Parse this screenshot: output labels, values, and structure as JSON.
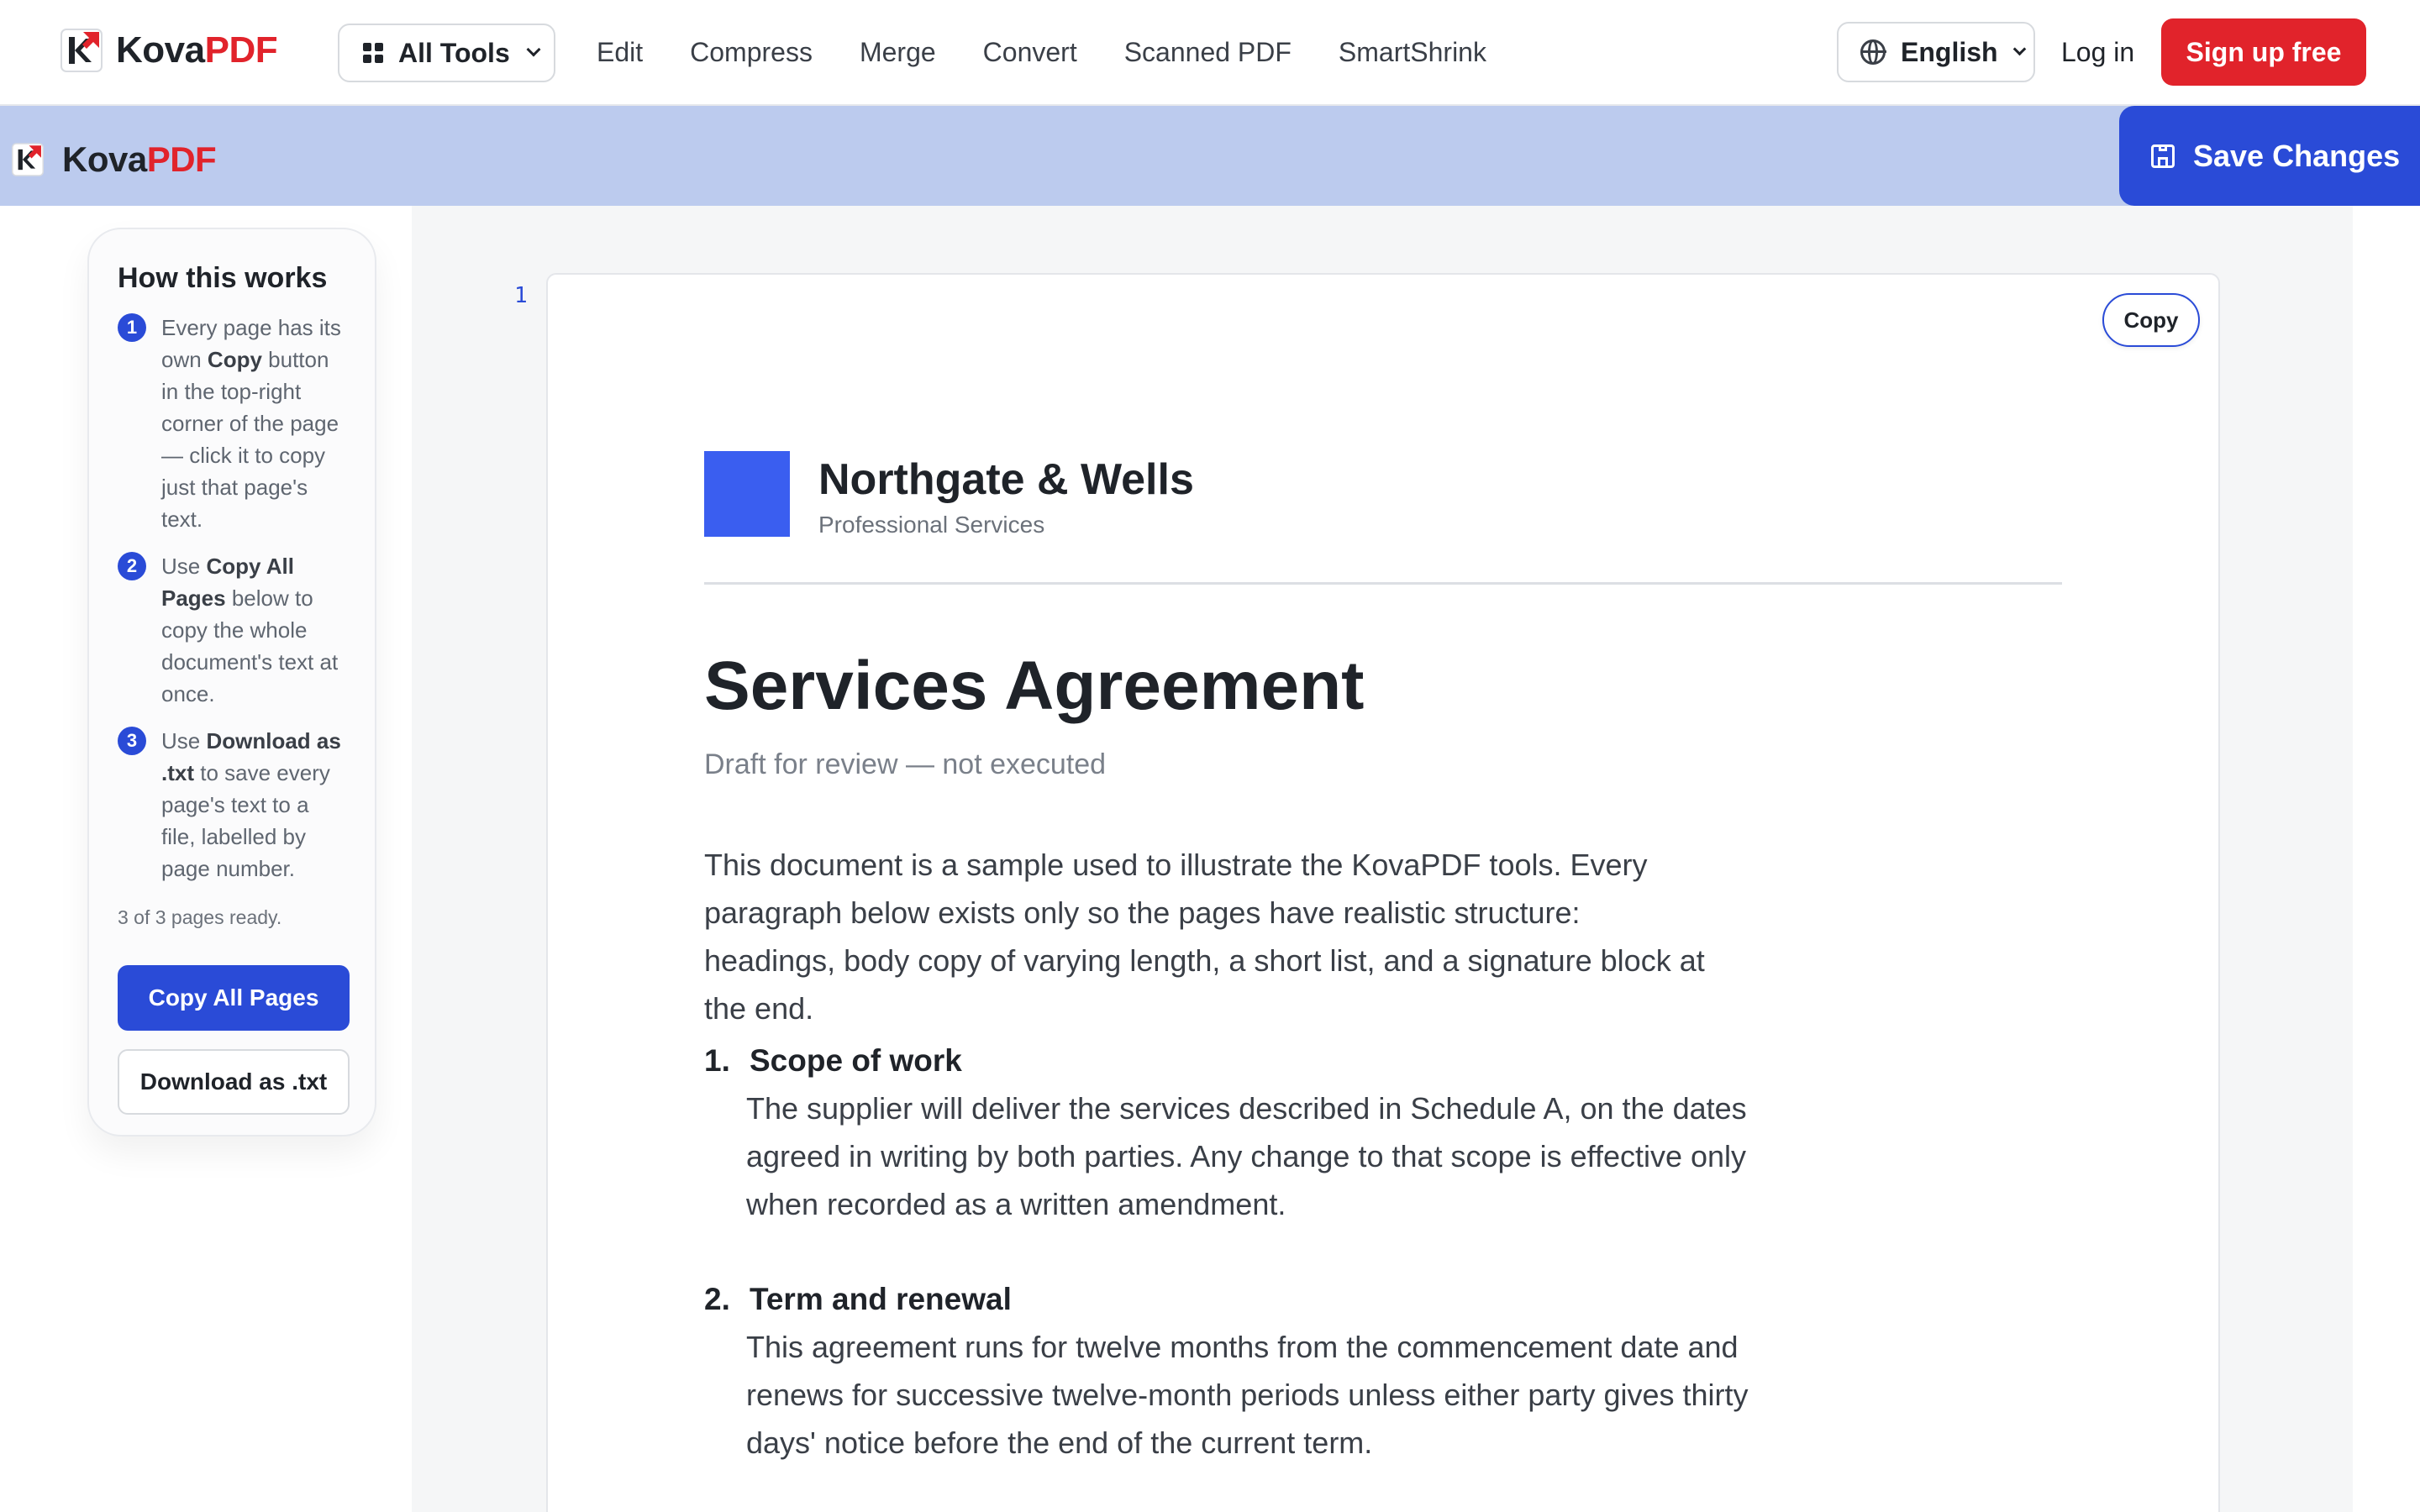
{
  "brand": {
    "kova": "Kova",
    "pdf": "PDF",
    "accent": "#e1232b",
    "primary": "#2a4bd7"
  },
  "topnav": {
    "all_tools": "All Tools",
    "links": [
      "Edit",
      "Compress",
      "Merge",
      "Convert",
      "Scanned PDF",
      "SmartShrink"
    ],
    "language": "English",
    "login": "Log in",
    "signup": "Sign up free"
  },
  "editor": {
    "save": "Save Changes"
  },
  "sidebar": {
    "title": "How this works",
    "steps": [
      {
        "num": "1",
        "pre": "Every page has its own ",
        "bold": "Copy",
        "post": " button in the top-right corner of the page — click it to copy just that page's text."
      },
      {
        "num": "2",
        "pre": "Use ",
        "bold": "Copy All Pages",
        "post": " below to copy the whole document's text at once."
      },
      {
        "num": "3",
        "pre": "Use ",
        "bold": "Download as .txt",
        "post": " to save every page's text to a file, labelled by page number."
      }
    ],
    "status": "3 of 3 pages ready.",
    "copy_all": "Copy All Pages",
    "download": "Download as .txt"
  },
  "document": {
    "page_number": "1",
    "copy": "Copy",
    "company": "Northgate & Wells",
    "company_sub": "Professional Services",
    "title": "Services Agreement",
    "subtitle": "Draft for review — not executed",
    "intro": "This document is a sample used to illustrate the KovaPDF tools. Every paragraph below exists only so the pages have realistic structure: headings, body copy of varying length, a short list, and a signature block at the end.",
    "sections": [
      {
        "num": "1.",
        "heading": "Scope of work",
        "body": "The supplier will deliver the services described in Schedule A, on the dates agreed in writing by both parties. Any change to that scope is effective only when recorded as a written amendment."
      },
      {
        "num": "2.",
        "heading": "Term and renewal",
        "body": "This agreement runs for twelve months from the commencement date and renews for successive twelve-month periods unless either party gives thirty days' notice before the end of the current term."
      }
    ]
  }
}
